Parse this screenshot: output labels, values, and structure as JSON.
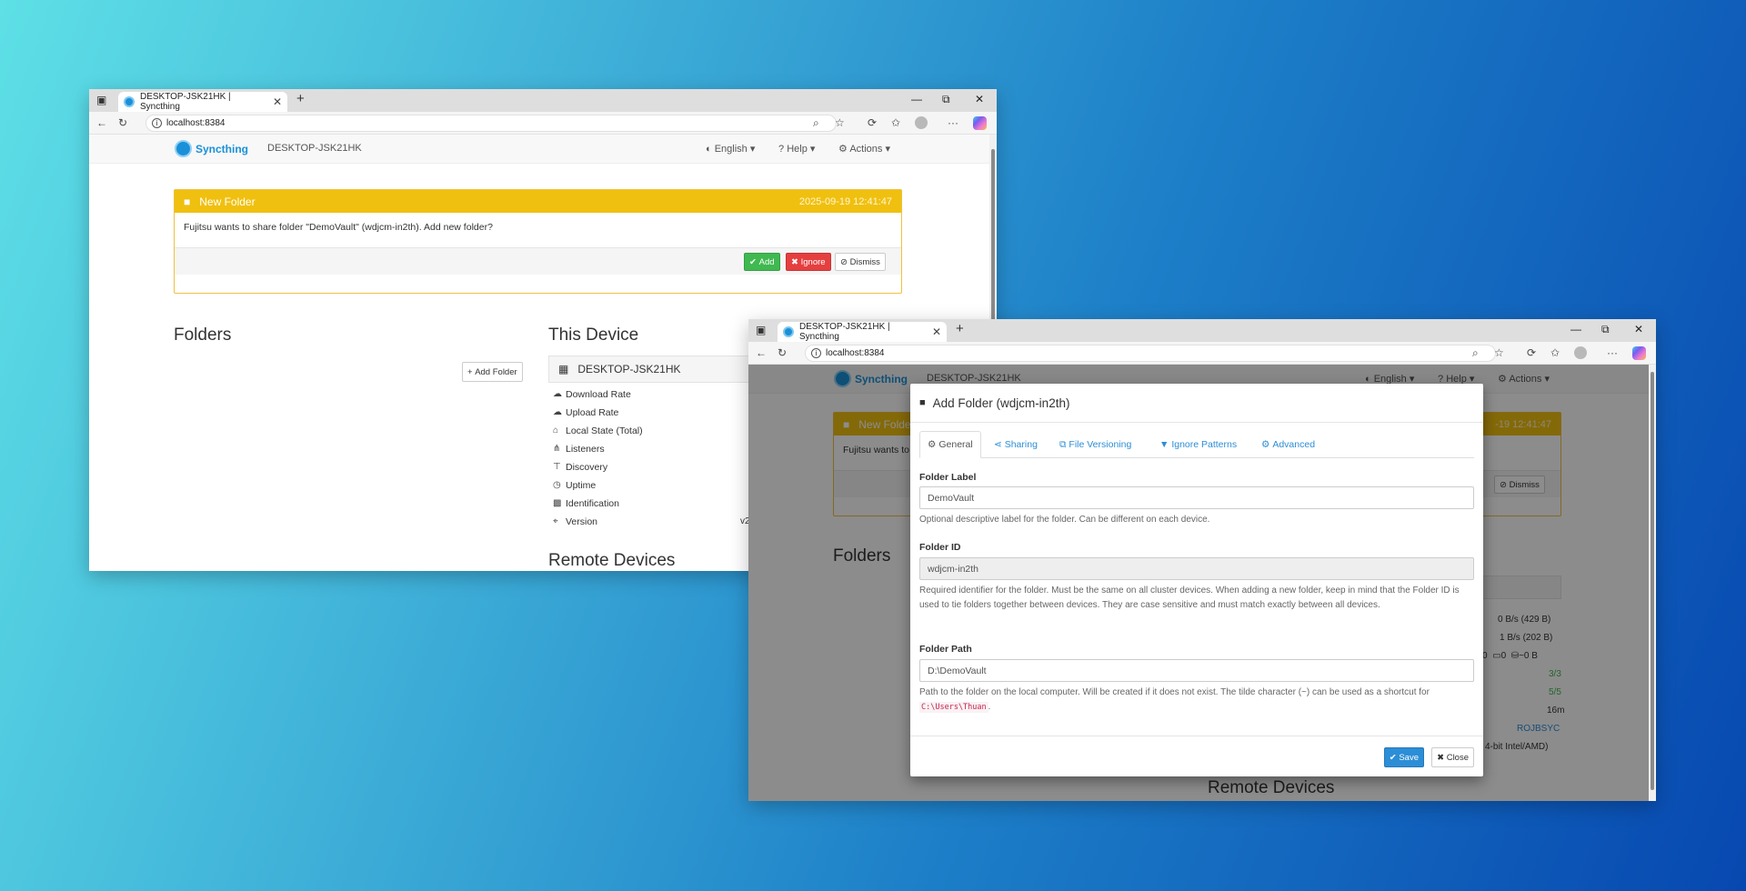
{
  "browser": {
    "tab_title": "DESKTOP-JSK21HK | Syncthing",
    "url": "localhost:8384"
  },
  "syncthing": {
    "brand": "Syncthing",
    "device_name": "DESKTOP-JSK21HK",
    "menu": {
      "language": "English",
      "help": "Help",
      "actions": "Actions"
    }
  },
  "notice": {
    "title": "New Folder",
    "timestamp": "2025-09-19 12:41:47",
    "timestamp_partial": "-19 12:41:47",
    "message": "Fujitsu wants to share folder \"DemoVault\" (wdjcm-in2th). Add new folder?",
    "message_partial": "Fujitsu wants to",
    "add_label": "Add",
    "ignore_label": "Ignore",
    "dismiss_label": "Dismiss"
  },
  "folders": {
    "heading": "Folders",
    "add_folder_label": "Add Folder"
  },
  "this_device": {
    "heading": "This Device",
    "name": "DESKTOP-JSK21HK",
    "rows": [
      {
        "label": "Download Rate",
        "value": "0 B/s (429 B)"
      },
      {
        "label": "Upload Rate",
        "value": "1 B/s (202 B)"
      },
      {
        "label": "Local State (Total)",
        "value": "~0 B"
      },
      {
        "label": "Listeners",
        "value": "3/3"
      },
      {
        "label": "Discovery",
        "value": "5/5"
      },
      {
        "label": "Uptime",
        "value": "16m"
      },
      {
        "label": "Identification",
        "value": "ROJBSYC"
      },
      {
        "label": "Version",
        "value": "v2"
      }
    ],
    "local_state_counts": "0",
    "local_state_folders": "0",
    "version_partial": "4-bit Intel/AMD)"
  },
  "remote_devices": {
    "heading": "Remote Devices"
  },
  "modal": {
    "title": "Add Folder (wdjcm-in2th)",
    "tabs": [
      "General",
      "Sharing",
      "File Versioning",
      "Ignore Patterns",
      "Advanced"
    ],
    "folder_label": {
      "label": "Folder Label",
      "value": "DemoVault",
      "help": "Optional descriptive label for the folder. Can be different on each device."
    },
    "folder_id": {
      "label": "Folder ID",
      "value": "wdjcm-in2th",
      "help": "Required identifier for the folder. Must be the same on all cluster devices. When adding a new folder, keep in mind that the Folder ID is used to tie folders together between devices. They are case sensitive and must match exactly between all devices."
    },
    "folder_path": {
      "label": "Folder Path",
      "value": "D:\\DemoVault",
      "help_before": "Path to the folder on the local computer. Will be created if it does not exist. The tilde character (~) can be used as a shortcut for",
      "help_code": "C:\\Users\\Thuan",
      "help_after": "."
    },
    "save_label": "Save",
    "close_label": "Close"
  }
}
